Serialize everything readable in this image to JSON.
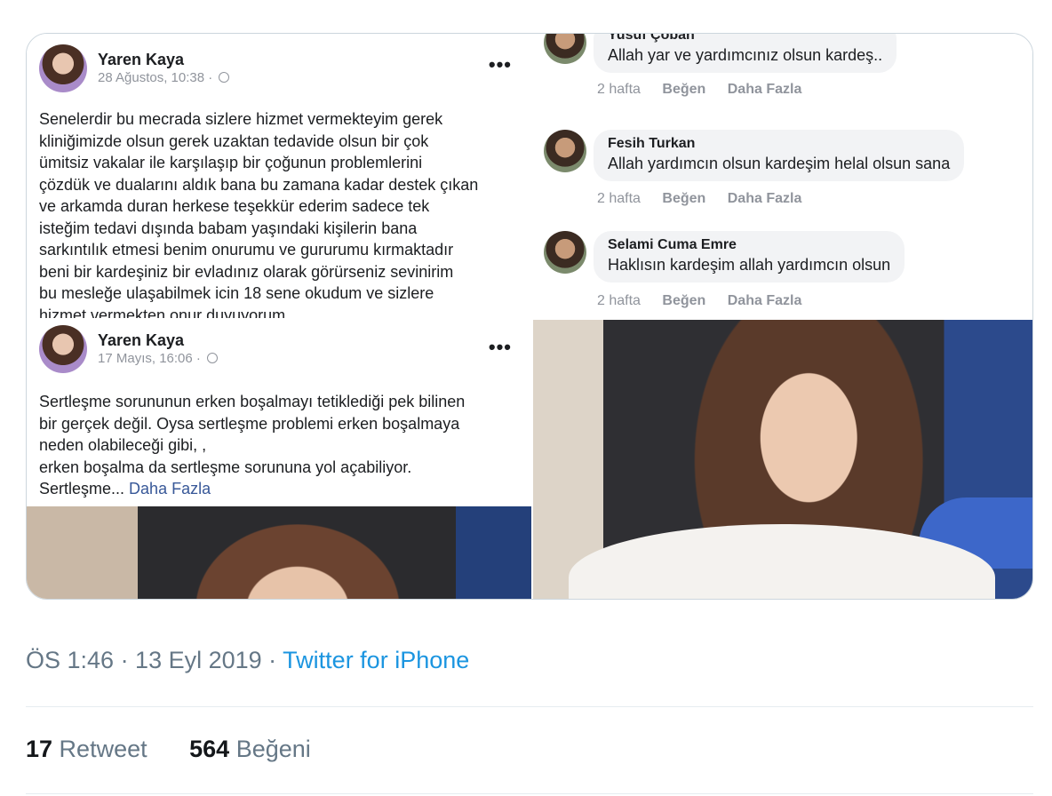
{
  "post1": {
    "author": "Yaren Kaya",
    "date": "28 Ağustos, 10:38 · ",
    "more_icon": "more-horizontal-icon",
    "lines": [
      "Senelerdir bu mecrada sizlere hizmet vermekteyim gerek",
      "kliniğimizde olsun gerek uzaktan tedavide olsun bir çok",
      "ümitsiz vakalar ile karşılaşıp bir çoğunun problemlerini",
      "çözdük ve dualarını aldık bana bu zamana kadar destek çıkan",
      "ve arkamda duran herkese teşekkür ederim sadece tek",
      "isteğim tedavi dışında babam yaşındaki kişilerin bana",
      "sarkıntılık etmesi benim onurumu ve gururumu kırmaktadır",
      "beni bir kardeşiniz bir evladınız olarak görürseniz sevinirim",
      "bu mesleğe ulaşabilmek icin 18 sene okudum ve sizlere",
      "hizmet vermekten onur duyuyorum"
    ]
  },
  "post2": {
    "author": "Yaren Kaya",
    "date": "17 Mayıs, 16:06 · ",
    "lines": [
      "Sertleşme sorununun erken boşalmayı tetiklediği pek bilinen",
      "bir gerçek değil. Oysa sertleşme problemi erken boşalmaya",
      "neden olabileceği gibi, ,",
      "erken boşalma da sertleşme sorununa yol açabiliyor."
    ],
    "last_line": "Sertleşme...",
    "more_link": "Daha Fazla"
  },
  "comments": [
    {
      "name": "Yusuf Çoban",
      "text": "Allah yar ve yardımcınız olsun kardeş..",
      "time": "2 hafta",
      "like": "Beğen",
      "more": "Daha Fazla"
    },
    {
      "name": "Fesih Turkan",
      "text": "Allah yardımcın olsun kardeşim helal olsun sana",
      "time": "2 hafta",
      "like": "Beğen",
      "more": "Daha Fazla"
    },
    {
      "name": "Selami Cuma Emre",
      "text": "Haklısın kardeşim allah yardımcın olsun",
      "time": "2 hafta",
      "like": "Beğen",
      "more": "Daha Fazla"
    }
  ],
  "tweet": {
    "timestamp": "ÖS 1:46 · 13 Eyl 2019 · ",
    "source": "Twitter for iPhone",
    "retweets": "17",
    "retweets_label": " Retweet",
    "likes": "564",
    "likes_label": " Beğeni"
  },
  "colors": {
    "link": "#1b95e0",
    "fb_link": "#385898",
    "muted": "#657786"
  }
}
